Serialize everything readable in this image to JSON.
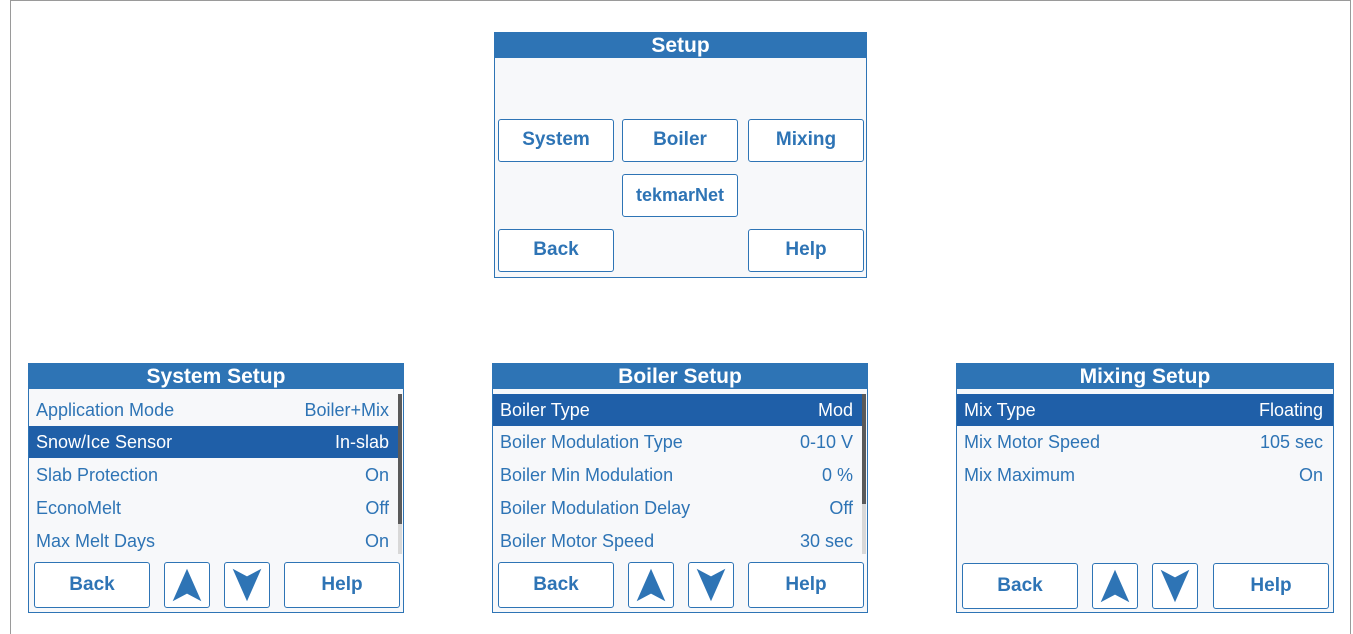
{
  "colors": {
    "accent": "#2e74b5",
    "selected": "#1f5fa8",
    "screen_bg": "#f7f8fa"
  },
  "setup": {
    "title": "Setup",
    "system": "System",
    "boiler": "Boiler",
    "mixing": "Mixing",
    "tekmarnet": "tekmarNet",
    "back": "Back",
    "help": "Help"
  },
  "system_setup": {
    "title": "System Setup",
    "rows": [
      {
        "label": "Application Mode",
        "value": "Boiler+Mix"
      },
      {
        "label": "Snow/Ice Sensor",
        "value": "In-slab"
      },
      {
        "label": "Slab Protection",
        "value": "On"
      },
      {
        "label": "EconoMelt",
        "value": "Off"
      },
      {
        "label": "Max Melt Days",
        "value": "On"
      }
    ],
    "back": "Back",
    "help": "Help"
  },
  "boiler_setup": {
    "title": "Boiler Setup",
    "rows": [
      {
        "label": "Boiler Type",
        "value": "Mod"
      },
      {
        "label": "Boiler Modulation Type",
        "value": "0-10 V"
      },
      {
        "label": "Boiler Min Modulation",
        "value": "0 %"
      },
      {
        "label": "Boiler Modulation Delay",
        "value": "Off"
      },
      {
        "label": "Boiler Motor Speed",
        "value": "30 sec"
      }
    ],
    "back": "Back",
    "help": "Help"
  },
  "mixing_setup": {
    "title": "Mixing Setup",
    "rows": [
      {
        "label": "Mix Type",
        "value": "Floating"
      },
      {
        "label": "Mix Motor Speed",
        "value": "105 sec"
      },
      {
        "label": "Mix Maximum",
        "value": "On"
      }
    ],
    "back": "Back",
    "help": "Help"
  }
}
